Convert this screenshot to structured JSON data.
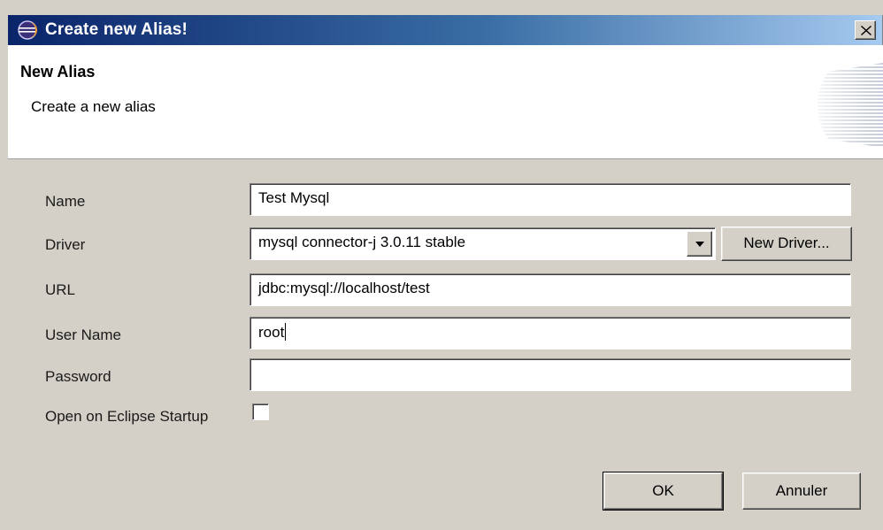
{
  "window": {
    "title": "Create new Alias!",
    "icon": "eclipse-icon",
    "close_icon": "close-icon"
  },
  "banner": {
    "title": "New Alias",
    "subtitle": "Create a new alias"
  },
  "form": {
    "name": {
      "label": "Name",
      "value": "Test Mysql"
    },
    "driver": {
      "label": "Driver",
      "selected": "mysql connector-j 3.0.11 stable",
      "new_driver_label": "New Driver..."
    },
    "url": {
      "label": "URL",
      "value": "jdbc:mysql://localhost/test"
    },
    "user_name": {
      "label": "User Name",
      "value": "root"
    },
    "password": {
      "label": "Password",
      "value": ""
    },
    "startup": {
      "label": "Open on Eclipse Startup",
      "checked": false
    }
  },
  "buttons": {
    "ok": "OK",
    "cancel": "Annuler"
  },
  "colors": {
    "title_gradient_start": "#0a246a",
    "title_gradient_end": "#a6caf0",
    "dialog_bg": "#d4d0c8"
  }
}
